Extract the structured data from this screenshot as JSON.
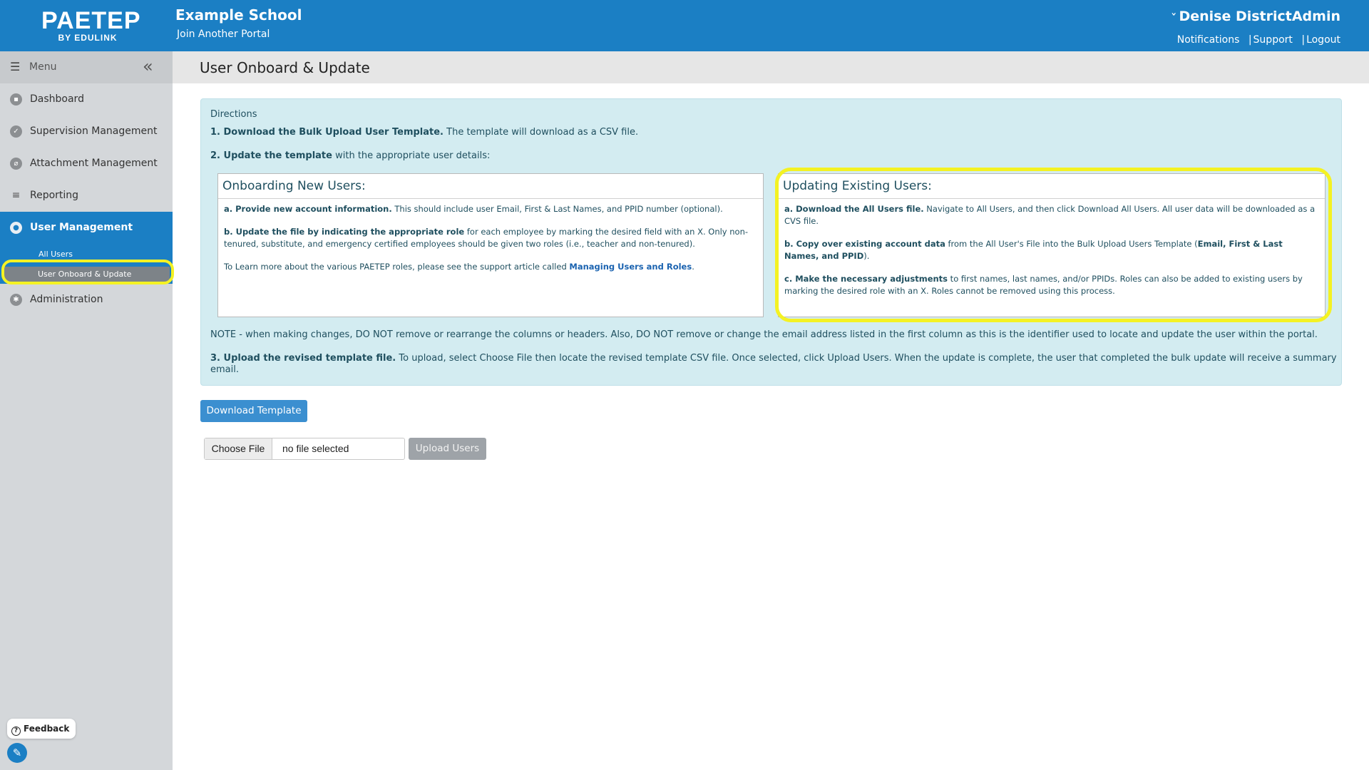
{
  "header": {
    "logo_main": "PAETEP",
    "logo_sub": "BY EDULINK",
    "school_name": "Example School",
    "join_portal": "Join Another Portal",
    "user_name": "Denise DistrictAdmin",
    "links": {
      "notifications": "Notifications",
      "support": "Support",
      "logout": "Logout",
      "separator": "|"
    },
    "color": "#1b7fc4"
  },
  "sidebar": {
    "menu_label": "Menu",
    "items": [
      {
        "label": "Dashboard",
        "icon": "dashboard-icon"
      },
      {
        "label": "Supervision Management",
        "icon": "check-circle-icon"
      },
      {
        "label": "Attachment Management",
        "icon": "paperclip-icon"
      },
      {
        "label": "Reporting",
        "icon": "bar-chart-icon"
      },
      {
        "label": "User Management",
        "icon": "user-icon"
      },
      {
        "label": "Administration",
        "icon": "gear-icon"
      }
    ],
    "sub_items": [
      {
        "label": "All Users"
      },
      {
        "label": "User Onboard & Update"
      }
    ],
    "feedback": "Feedback"
  },
  "page": {
    "title": "User Onboard & Update"
  },
  "directions": {
    "heading": "Directions",
    "step1_strong": "1. Download the Bulk Upload User Template.",
    "step1_rest": " The template will download as a CSV file.",
    "step2_strong": "2. Update the template",
    "step2_rest": " with the appropriate user details:",
    "new_users": {
      "title": "Onboarding New Users:",
      "a_strong": "a. Provide new account information.",
      "a_rest": " This should include user Email, First & Last Names, and PPID number (optional).",
      "b_strong": "b. Update the file by indicating the appropriate role",
      "b_rest": " for each employee by marking the desired field with an X. Only non-tenured, substitute, and emergency certified employees should be given two roles (i.e., teacher and non-tenured).",
      "c_text": "To Learn more about the various PAETEP roles, please see the support article called ",
      "c_link": "Managing Users and Roles",
      "c_end": "."
    },
    "existing_users": {
      "title": "Updating Existing Users:",
      "a_strong": "a. Download the All Users file.",
      "a_rest": " Navigate to All Users, and then click Download All Users. All user data will be downloaded as a CVS file.",
      "b_strong": "b. Copy over existing account data",
      "b_rest": " from the All User's File into the Bulk Upload Users Template (",
      "b_strong2": "Email, First & Last Names, and PPID",
      "b_end": ").",
      "c_strong": "c. Make the necessary adjustments",
      "c_rest": " to first names, last names, and/or PPIDs. Roles can also be added to existing users by marking the desired role with an X. Roles cannot be removed using this process."
    },
    "note": "NOTE - when making changes, DO NOT remove or rearrange the columns or headers. Also, DO NOT remove or change the email address listed in the first column as this is the identifier used to locate and update the user within the portal.",
    "step3_strong": "3. Upload the revised template file.",
    "step3_rest": " To upload, select Choose File then locate the revised template CSV file. Once selected, click Upload Users. When the update is complete, the user that completed the bulk update will receive a summary email."
  },
  "actions": {
    "download_template": "Download Template",
    "choose_file": "Choose File",
    "file_status": "no file selected",
    "upload_users": "Upload Users"
  }
}
